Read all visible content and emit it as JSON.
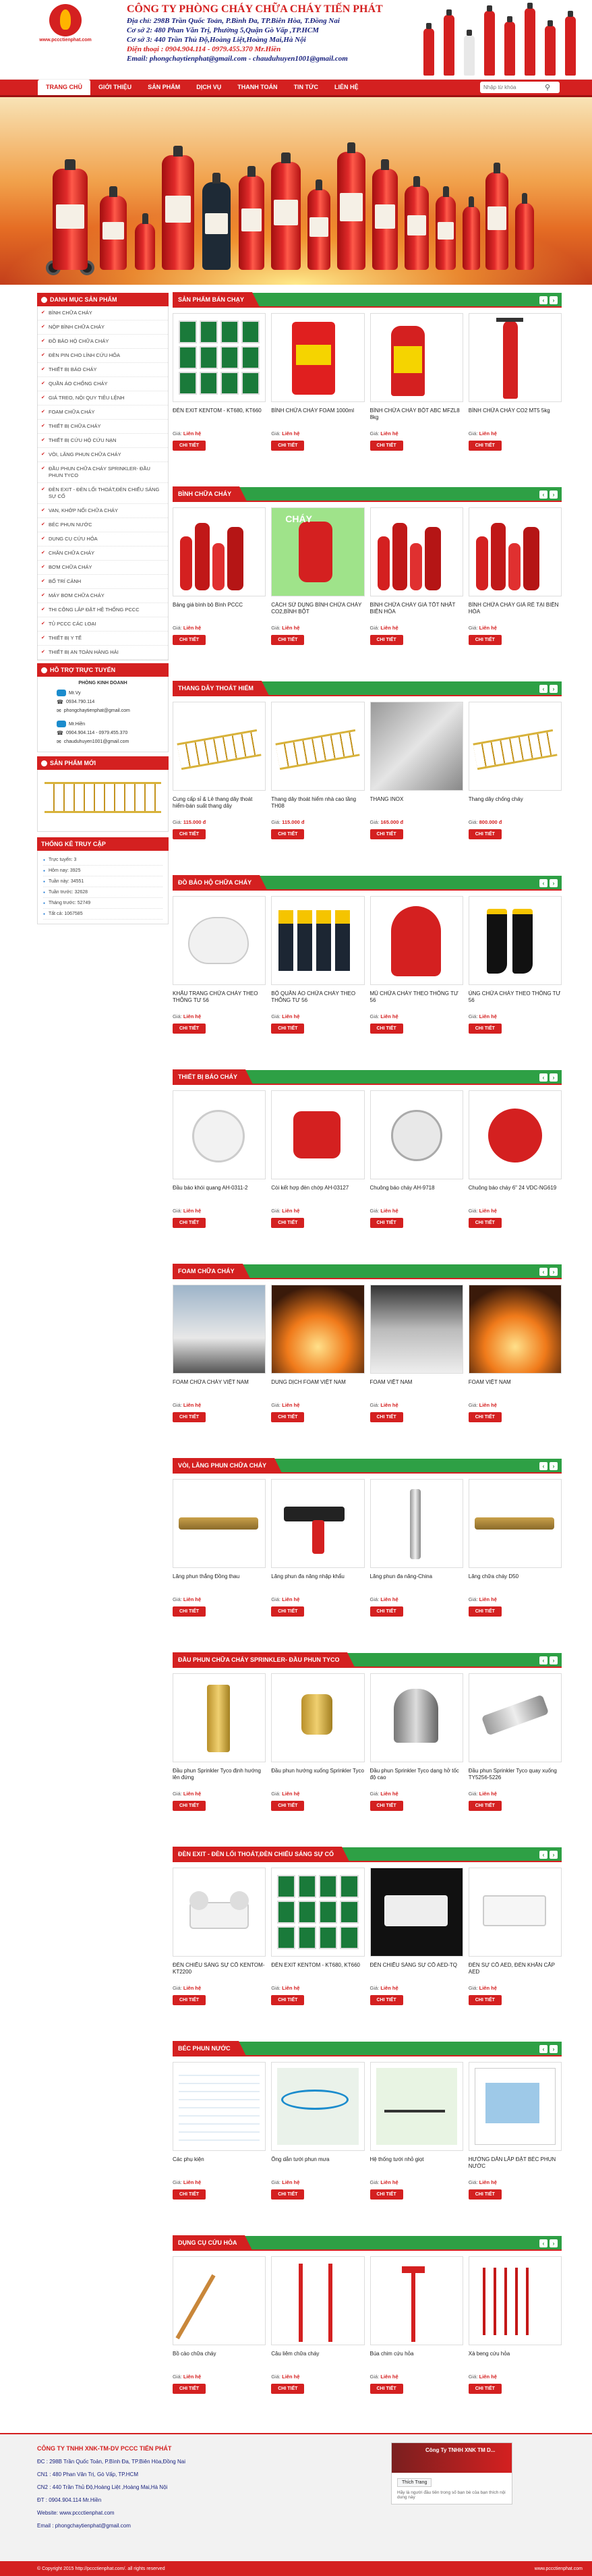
{
  "header": {
    "logo_text": "www.pccctienphat.com",
    "company": "CÔNG TY PHÒNG CHÁY CHỮA CHÁY TIẾN PHÁT",
    "addr1": "Địa chỉ:  298B Trần Quốc Toản, P.Bình Đa, TP.Biên Hòa, T.Đồng Nai",
    "addr2": "Cơ sở 2: 480 Phan Văn Trị, Phường 5,Quận Gò Vấp ,TP.HCM",
    "addr3": "Cơ sở 3: 440 Trần Thủ Độ,Hoàng Liệt,Hoàng Mai,Hà Nội",
    "phone": "Điện thoại : 0904.904.114 - 0979.455.370 Mr.Hiền",
    "email": "Email: phongchaytienphat@gmail.com - chauduhuyen1001@gmail.com"
  },
  "nav": {
    "items": [
      "TRANG CHỦ",
      "GIỚI THIỆU",
      "SẢN PHẨM",
      "DỊCH VỤ",
      "THANH TOÁN",
      "TIN TỨC",
      "LIÊN HỆ"
    ],
    "search_placeholder": "Nhập từ khóa"
  },
  "sidebar": {
    "cat_title": "DANH MỤC SẢN PHẨM",
    "categories": [
      "BÌNH CHỮA CHÁY",
      "NỘP BÌNH CHỮA CHÁY",
      "ĐỒ BẢO HỘ CHỮA CHÁY",
      "ĐÈN PIN CHO LÍNH CỨU HỎA",
      "THIẾT BỊ BÁO CHÁY",
      "QUẦN ÁO CHỐNG CHÁY",
      "GIÁ TREO, NỘI QUY TIÊU LỆNH",
      "FOAM CHỮA CHÁY",
      "THIẾT BỊ CHỮA CHÁY",
      "THIẾT BỊ CỨU HỘ CỨU NẠN",
      "VÒI, LĂNG PHUN CHỮA CHÁY",
      "ĐẦU PHUN CHỮA CHÁY SPRINKLER- ĐẦU PHUN TYCO",
      "ĐÈN EXIT - ĐÈN LỐI THOÁT,ĐÈN CHIẾU SÁNG SỰ CỐ",
      "VAN, KHỚP NỐI CHỮA CHÁY",
      "BÉC PHUN NƯỚC",
      "DỤNG CỤ CỨU HỎA",
      "CHĂN CHỮA CHÁY",
      "BƠM CHỮA CHÁY",
      "BỐ TRÍ CẢNH",
      "MÁY BƠM CHỮA CHÁY",
      "THI CÔNG LẮP ĐẶT HỆ THỐNG PCCC",
      "TỦ PCCC CÁC LOẠI",
      "THIẾT BỊ Y TẾ",
      "THIẾT BỊ AN TOÀN HÀNG HẢI"
    ],
    "support_title": "HỖ TRỢ TRỰC TUYẾN",
    "support_dept": "PHÒNG KINH DOANH",
    "support_name1": "Mr.Vy",
    "support_phone1": "0934.790.114",
    "support_mail1": "phongchaytienphat@gmail.com",
    "support_name2": "Mr.Hiền",
    "support_phone2": "0904.904.114 - 0979.455.370",
    "support_mail2": "chauduhuyen1001@gmail.com",
    "new_title": "SẢN PHẨM MỚI",
    "stats_title": "THỐNG KÊ TRUY CẬP",
    "stats": [
      "Trực tuyến:  3",
      "Hôm nay:  3925",
      "Tuần này:  34551",
      "Tuần trước:  32628",
      "Tháng trước:  52749",
      "Tất cả:  1067585"
    ]
  },
  "price_label": "Giá:",
  "price_contact": "Liên hệ",
  "detail_label": "CHI TIẾT",
  "sections": [
    {
      "title": "SẢN PHẨM BÁN CHẠY",
      "products": [
        {
          "name": "ĐÈN EXIT KENTOM - KT680, KT660",
          "price": "Liên hệ",
          "img": "exit"
        },
        {
          "name": "BÌNH CHỮA CHÁY FOAM 1000ml",
          "price": "Liên hệ",
          "img": "can"
        },
        {
          "name": "BÌNH CHỮA CHÁY BỘT ABC MFZL8 8kg",
          "price": "Liên hệ",
          "img": "ext2"
        },
        {
          "name": "BÌNH CHỮA CHÁY CO2 MT5 5kg",
          "price": "Liên hệ",
          "img": "ext1"
        }
      ]
    },
    {
      "title": "BÌNH CHỮA CHÁY",
      "products": [
        {
          "name": "Bảng giá bình bộ Bình PCCC",
          "price": "Liên hệ",
          "img": "ext3"
        },
        {
          "name": "CÁCH SỬ DỤNG BÌNH CHỮA CHÁY CO2,BÌNH BỘT",
          "price": "Liên hệ",
          "img": "ext4"
        },
        {
          "name": "BÌNH CHỮA CHÁY GIÁ TỐT NHẤT BIÊN HÒA",
          "price": "Liên hệ",
          "img": "ext3"
        },
        {
          "name": "BÌNH CHỮA CHÁY GIÁ RẺ TẠI BIÊN HÒA",
          "price": "Liên hệ",
          "img": "ext3"
        }
      ]
    },
    {
      "title": "THANG DÂY THOÁT HIỂM",
      "products": [
        {
          "name": "Cung cấp sỉ & Lẻ thang dây thoát hiểm-bán suất thang dây",
          "price": "115.000 đ",
          "img": "ladder"
        },
        {
          "name": "Thang dây thoát hiểm nhà cao tầng TH08",
          "price": "115.000 đ",
          "img": "ladder"
        },
        {
          "name": "THANG INOX",
          "price": "165.000 đ",
          "img": "inox"
        },
        {
          "name": "Thang dây chống cháy",
          "price": "800.000 đ",
          "img": "ladder"
        }
      ]
    },
    {
      "title": "ĐỒ BẢO HỘ CHỮA CHÁY",
      "products": [
        {
          "name": "KHẨU TRANG CHỮA CHÁY THEO THÔNG TƯ 56",
          "price": "Liên hệ",
          "img": "mask"
        },
        {
          "name": "BỘ QUẦN ÁO CHỮA CHÁY THEO THÔNG TƯ 56",
          "price": "Liên hệ",
          "img": "suit"
        },
        {
          "name": "MŨ CHỮA CHÁY THEO THÔNG TƯ 56",
          "price": "Liên hệ",
          "img": "hood"
        },
        {
          "name": "ỦNG CHỮA CHÁY THEO THÔNG TƯ 56",
          "price": "Liên hệ",
          "img": "boots"
        }
      ]
    },
    {
      "title": "THIẾT BỊ BÁO CHÁY",
      "products": [
        {
          "name": "Đầu báo khói quang AH-0311-2",
          "price": "Liên hệ",
          "img": "smoke"
        },
        {
          "name": "Còi kết hợp đèn chớp AH-03127",
          "price": "Liên hệ",
          "img": "siren"
        },
        {
          "name": "Chuông báo cháy AH-9718",
          "price": "Liên hệ",
          "img": "bell"
        },
        {
          "name": "Chuông báo cháy 6\" 24 VDC-NG619",
          "price": "Liên hệ",
          "img": "bellred"
        }
      ]
    },
    {
      "title": "FOAM CHỮA CHÁY",
      "products": [
        {
          "name": "FOAM CHỮA CHÁY VIỆT NAM",
          "price": "Liên hệ",
          "img": "foam"
        },
        {
          "name": "DUNG DỊCH FOAM VIỆT NAM",
          "price": "Liên hệ",
          "img": "fire"
        },
        {
          "name": "FOAM VIỆT NAM",
          "price": "Liên hệ",
          "img": "foam2"
        },
        {
          "name": "FOAM VIỆT NAM",
          "price": "Liên hệ",
          "img": "fire"
        }
      ]
    },
    {
      "title": "VÒI, LĂNG PHUN CHỮA CHÁY",
      "products": [
        {
          "name": "Lăng phun thẳng Đồng thau",
          "price": "Liên hệ",
          "img": "nozzle"
        },
        {
          "name": "Lăng phun đa năng nhập khẩu",
          "price": "Liên hệ",
          "img": "gun"
        },
        {
          "name": "Lăng phun đa năng-China",
          "price": "Liên hệ",
          "img": "nozzle2"
        },
        {
          "name": "Lăng chữa cháy D50",
          "price": "Liên hệ",
          "img": "nozzle"
        }
      ]
    },
    {
      "title": "ĐẦU PHUN CHỮA CHÁY SPRINKLER- ĐẦU PHUN TYCO",
      "products": [
        {
          "name": "Đầu phun Sprinkler Tyco định hướng lên đứng",
          "price": "Liên hệ",
          "img": "sprink"
        },
        {
          "name": "Đầu phun hướng xuống Sprinkler Tyco",
          "price": "Liên hệ",
          "img": "sprink2"
        },
        {
          "name": "Đầu phun Sprinkler Tyco dạng hở tốc độ cao",
          "price": "Liên hệ",
          "img": "sprink3"
        },
        {
          "name": "Đầu phun Sprinkler Tyco quay xuống TY5256-5226",
          "price": "Liên hệ",
          "img": "sprink4"
        }
      ]
    },
    {
      "title": "ĐÈN EXIT - ĐÈN LỐI THOÁT,ĐÈN CHIẾU SÁNG SỰ CỐ",
      "products": [
        {
          "name": "ĐÈN CHIẾU SÁNG SỰ CỐ KENTOM-KT2200",
          "price": "Liên hệ",
          "img": "emlight"
        },
        {
          "name": "ĐÈN EXIT KENTOM - KT680, KT660",
          "price": "Liên hệ",
          "img": "exit"
        },
        {
          "name": "ĐÈN CHIẾU SÁNG SỰ CỐ AED-TQ",
          "price": "Liên hệ",
          "img": "emlight2"
        },
        {
          "name": "ĐÈN SỰ CỐ AED, ĐÈN KHẨN CẤP AED",
          "price": "Liên hệ",
          "img": "emlight3"
        }
      ]
    },
    {
      "title": "BÉC PHUN NƯỚC",
      "products": [
        {
          "name": "Các phụ kiện",
          "price": "Liên hệ",
          "img": "doc"
        },
        {
          "name": "Ống dẫn tưới phun mưa",
          "price": "Liên hệ",
          "img": "doc2"
        },
        {
          "name": "Hệ thống tưới nhỏ giọt",
          "price": "Liên hệ",
          "img": "doc3"
        },
        {
          "name": "HƯỚNG DẪN LẮP ĐẶT BÉC PHUN NƯỚC",
          "price": "Liên hệ",
          "img": "doc4"
        }
      ]
    },
    {
      "title": "DỤNG CỤ CỨU HỎA",
      "products": [
        {
          "name": "Bồ cào chữa cháy",
          "price": "Liên hệ",
          "img": "rake"
        },
        {
          "name": "Câu liêm chữa cháy",
          "price": "Liên hệ",
          "img": "hook"
        },
        {
          "name": "Búa chim cứu hỏa",
          "price": "Liên hệ",
          "img": "axe"
        },
        {
          "name": "Xà beng cứu hỏa",
          "price": "Liên hệ",
          "img": "bar"
        }
      ]
    }
  ],
  "footer": {
    "name": "CÔNG TY TNHH XNK-TM-DV PCCC TIẾN PHÁT",
    "l1": "ĐC :  298B Trần Quốc Toản, P.Bình Đa, TP.Biên Hòa,Đồng Nai",
    "l2": "CN1 :  480 Phan Văn Trị, Gò Vấp, TP.HCM",
    "l3": "CN2 :  440 Trần Thủ Độ,Hoàng Liệt ,Hoàng Mai,Hà Nội",
    "l4": "ĐT :  0904.904.114 Mr.Hiền",
    "l5": "Website: www.pccctienphat.com",
    "l6": "Email :  phongchaytienphat@gmail.com",
    "fb_name": "Công Ty TNHH XNK TM D...",
    "fb_btn": "Thích Trang",
    "fb_msg": "Hãy là người đầu tiên trong số bạn bè của bạn thích nội dung này",
    "copyright": "© Copyright 2015 http://pccctienphat.com/. all rights reserved",
    "site": "www.pccctienphat.com"
  }
}
